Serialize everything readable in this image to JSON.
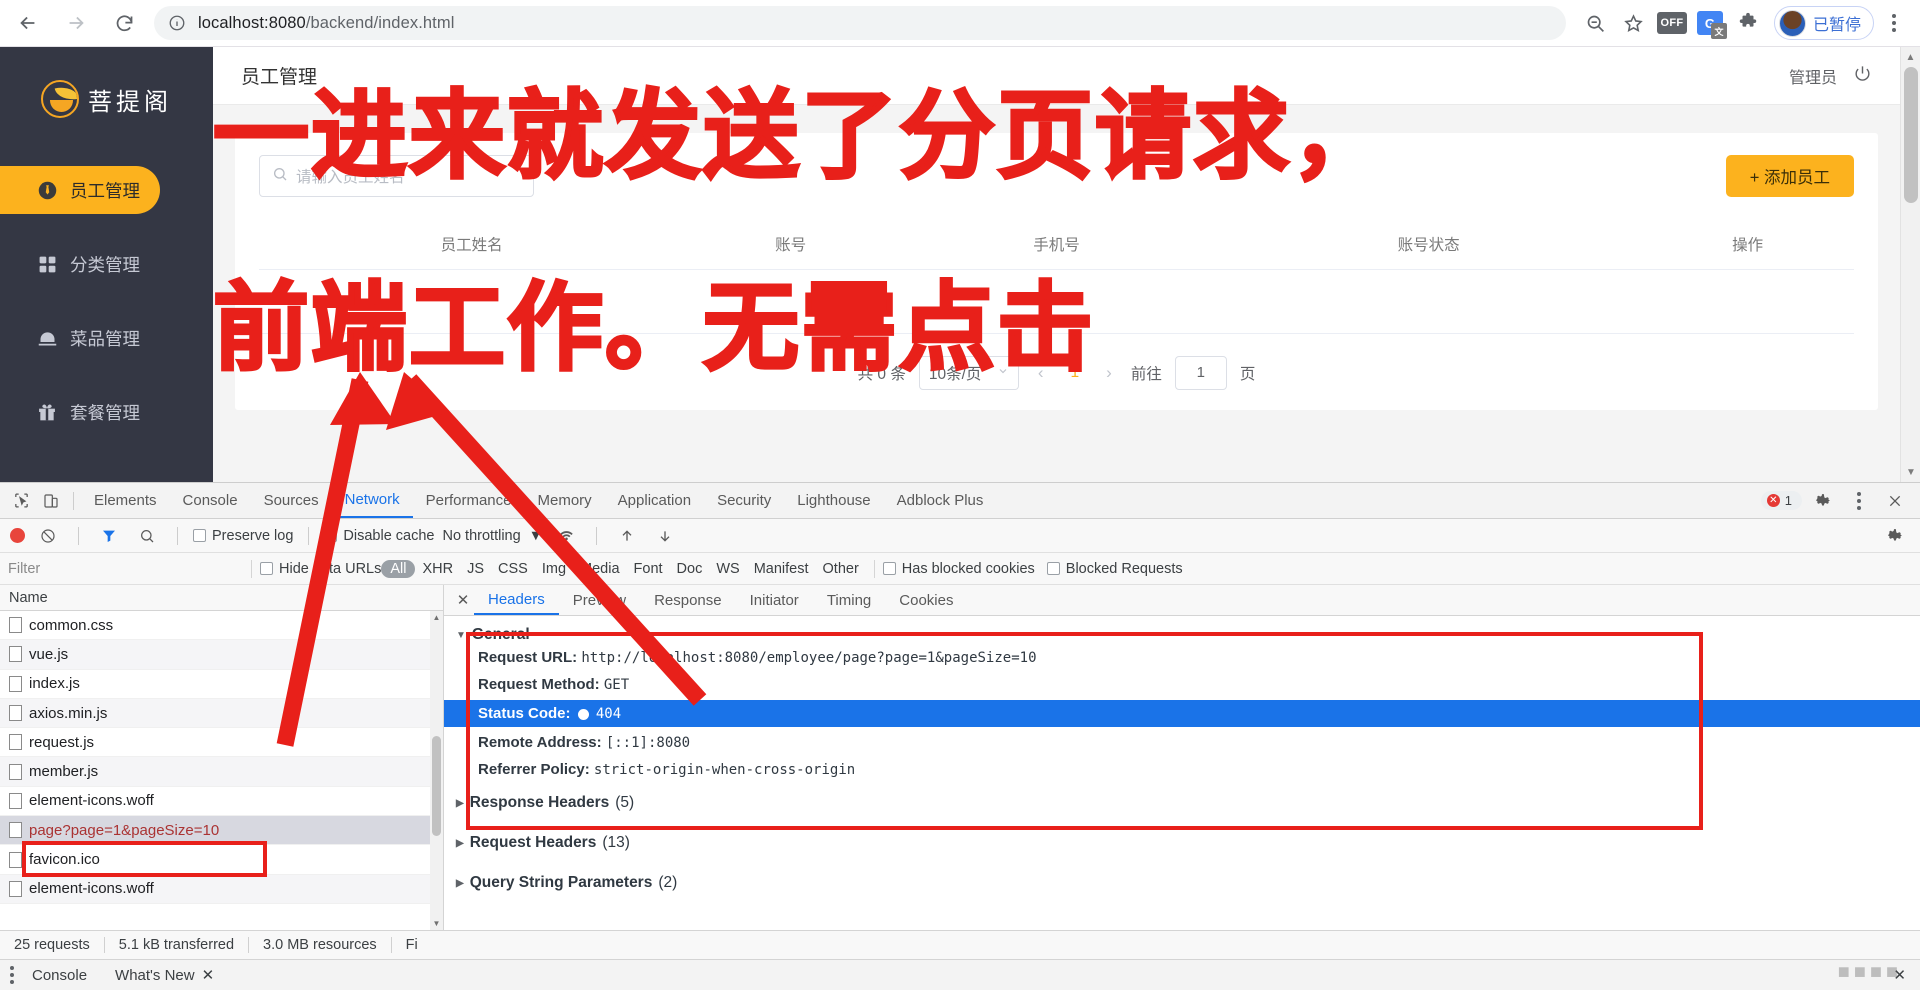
{
  "browser": {
    "url_prefix": "localhost:8080",
    "url_path": "/backend/index.html",
    "back_icon": "back-arrow-icon",
    "forward_icon": "forward-arrow-icon",
    "reload_icon": "reload-icon",
    "info_icon": "info-circle-icon",
    "zoom_icon": "zoom-out-icon",
    "bookmark_icon": "star-icon",
    "off_badge": "OFF",
    "translate_icon": "google-translate-icon",
    "extensions_icon": "puzzle-piece-icon",
    "profile_label": "已暂停",
    "menu_icon": "kebab-menu-icon"
  },
  "sidebar": {
    "brand": "菩提阁",
    "items": [
      {
        "label": "员工管理",
        "icon": "tie-icon",
        "active": true
      },
      {
        "label": "分类管理",
        "icon": "grid-icon",
        "active": false
      },
      {
        "label": "菜品管理",
        "icon": "dish-cover-icon",
        "active": false
      },
      {
        "label": "套餐管理",
        "icon": "gift-icon",
        "active": false
      }
    ]
  },
  "header": {
    "title": "员工管理",
    "user": "管理员",
    "power_icon": "power-icon"
  },
  "content": {
    "search_placeholder": "请输入员工姓名",
    "search_value": "",
    "search_icon": "search-icon",
    "add_button": "+ 添加员工",
    "table_headers": [
      "员工姓名",
      "账号",
      "手机号",
      "账号状态",
      "操作"
    ],
    "rows": []
  },
  "pagination": {
    "total_text": "共 0 条",
    "page_size": "10条/页",
    "prev_icon": "chevron-left-icon",
    "current_page": "1",
    "next_icon": "chevron-right-icon",
    "goto_label": "前往",
    "goto_value": "1",
    "page_unit": "页"
  },
  "devtools": {
    "inspect_icon": "inspect-element-icon",
    "device_icon": "device-toolbar-icon",
    "tabs": [
      {
        "label": "Elements",
        "active": false
      },
      {
        "label": "Console",
        "active": false
      },
      {
        "label": "Sources",
        "active": false
      },
      {
        "label": "Network",
        "active": true
      },
      {
        "label": "Performance",
        "active": false
      },
      {
        "label": "Memory",
        "active": false
      },
      {
        "label": "Application",
        "active": false
      },
      {
        "label": "Security",
        "active": false
      },
      {
        "label": "Lighthouse",
        "active": false
      },
      {
        "label": "Adblock Plus",
        "active": false
      }
    ],
    "error_count": "1",
    "settings_icon": "gear-icon",
    "more_icon": "kebab-menu-icon",
    "close_icon": "close-icon",
    "network_toolbar": {
      "record_icon": "record-stop-icon",
      "clear_icon": "clear-icon",
      "filter_icon": "funnel-icon",
      "search_icon": "search-icon",
      "preserve_log": "Preserve log",
      "disable_cache": "Disable cache",
      "throttling": "No throttling",
      "throttle_caret": "▼",
      "wifi_icon": "network-conditions-icon",
      "import_icon": "upload-har-icon",
      "export_icon": "download-har-icon",
      "settings_icon": "gear-icon"
    },
    "filter_bar": {
      "filter_placeholder": "Filter",
      "hide_data_urls": "Hide data URLs",
      "types": [
        "All",
        "XHR",
        "JS",
        "CSS",
        "Img",
        "Media",
        "Font",
        "Doc",
        "WS",
        "Manifest",
        "Other"
      ],
      "selected_type": "All",
      "has_blocked_cookies": "Has blocked cookies",
      "blocked_requests": "Blocked Requests"
    },
    "request_list": {
      "column_header": "Name",
      "rows": [
        {
          "name": "common.css",
          "selected": false
        },
        {
          "name": "vue.js",
          "selected": false
        },
        {
          "name": "index.js",
          "selected": false
        },
        {
          "name": "axios.min.js",
          "selected": false
        },
        {
          "name": "request.js",
          "selected": false
        },
        {
          "name": "member.js",
          "selected": false
        },
        {
          "name": "element-icons.woff",
          "selected": false
        },
        {
          "name": "page?page=1&pageSize=10",
          "selected": true
        },
        {
          "name": "favicon.ico",
          "selected": false
        },
        {
          "name": "element-icons.woff",
          "selected": false
        }
      ]
    },
    "detail_tabs": [
      {
        "label": "Headers",
        "active": true
      },
      {
        "label": "Preview",
        "active": false
      },
      {
        "label": "Response",
        "active": false
      },
      {
        "label": "Initiator",
        "active": false
      },
      {
        "label": "Timing",
        "active": false
      },
      {
        "label": "Cookies",
        "active": false
      }
    ],
    "general": {
      "section_title": "General",
      "request_url_label": "Request URL:",
      "request_url_value": "http://localhost:8080/employee/page?page=1&pageSize=10",
      "request_method_label": "Request Method:",
      "request_method_value": "GET",
      "status_code_label": "Status Code:",
      "status_code_value": "404",
      "remote_address_label": "Remote Address:",
      "remote_address_value": "[::1]:8080",
      "referrer_policy_label": "Referrer Policy:",
      "referrer_policy_value": "strict-origin-when-cross-origin"
    },
    "collapsed_sections": [
      {
        "label": "Response Headers",
        "count": "(5)"
      },
      {
        "label": "Request Headers",
        "count": "(13)"
      },
      {
        "label": "Query String Parameters",
        "count": "(2)"
      }
    ],
    "status_bar": {
      "requests": "25 requests",
      "transferred": "5.1 kB transferred",
      "resources": "3.0 MB resources",
      "finish": "Fi"
    },
    "drawer": {
      "more_icon": "kebab-menu-icon",
      "tabs": [
        "Console",
        "What's New"
      ],
      "close_icon": "close-icon"
    }
  },
  "annotation": {
    "line1": "一进来就发送了分页请求，",
    "line2": "前端工作。无需点击",
    "color": "#e8201a"
  }
}
